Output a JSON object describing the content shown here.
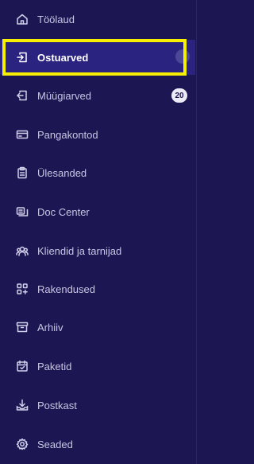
{
  "sidebar": {
    "items": [
      {
        "label": "Töölaud",
        "icon": "home-icon"
      },
      {
        "label": "Ostuarved",
        "icon": "invoice-in-icon",
        "active": true
      },
      {
        "label": "Müügiarved",
        "icon": "invoice-out-icon",
        "badge": "20"
      },
      {
        "label": "Pangakontod",
        "icon": "bank-card-icon"
      },
      {
        "label": "Ülesanded",
        "icon": "clipboard-icon"
      },
      {
        "label": "Doc Center",
        "icon": "documents-icon"
      },
      {
        "label": "Kliendid ja tarnijad",
        "icon": "users-icon"
      },
      {
        "label": "Rakendused",
        "icon": "apps-icon"
      },
      {
        "label": "Arhiiv",
        "icon": "archive-icon"
      },
      {
        "label": "Paketid",
        "icon": "calendar-icon"
      },
      {
        "label": "Postkast",
        "icon": "inbox-download-icon"
      },
      {
        "label": "Seaded",
        "icon": "gear-icon"
      }
    ]
  },
  "colors": {
    "background": "#1c1653",
    "active_background": "#2a2380",
    "highlight": "#f6f000",
    "badge_background": "#eceaf6"
  }
}
